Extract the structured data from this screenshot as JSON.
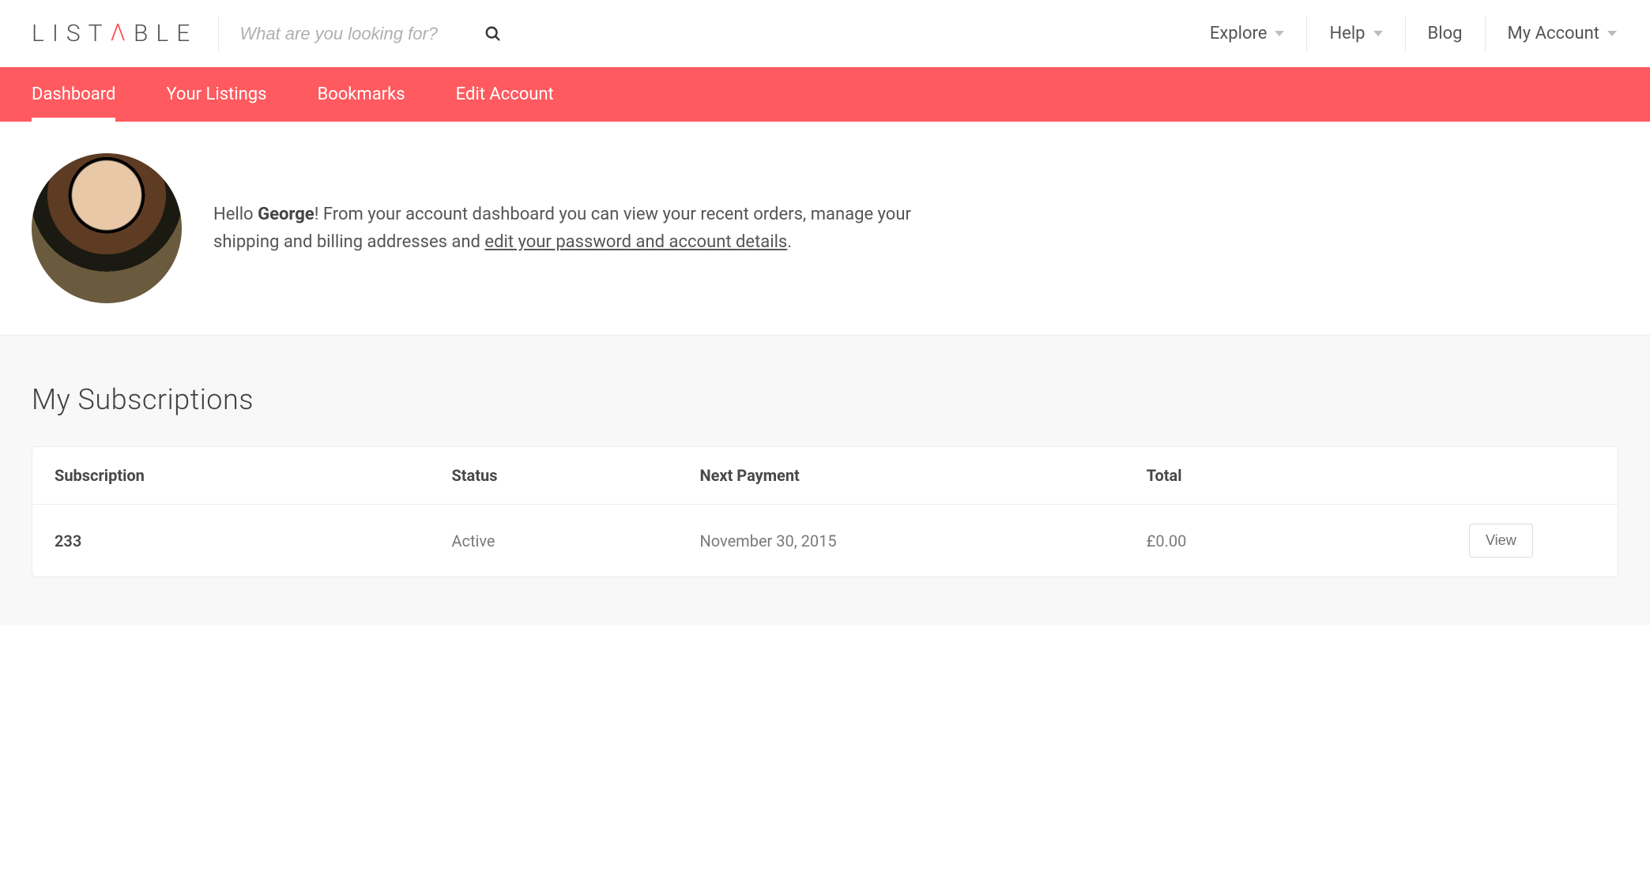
{
  "brand": {
    "name_html_pieces": [
      "L",
      "I",
      "S",
      "T",
      "A",
      "B",
      "L",
      "E"
    ],
    "accent_index": 4
  },
  "search": {
    "placeholder": "What are you looking for?"
  },
  "topnav": {
    "explore": "Explore",
    "help": "Help",
    "blog": "Blog",
    "my_account": "My Account"
  },
  "tabs": {
    "dashboard": "Dashboard",
    "your_listings": "Your Listings",
    "bookmarks": "Bookmarks",
    "edit_account": "Edit Account"
  },
  "welcome": {
    "hello": "Hello ",
    "name": "George",
    "after_name": "! From your account dashboard you can view your recent orders, manage your shipping and billing addresses and ",
    "edit_link": "edit your password and account details",
    "period": "."
  },
  "subscriptions": {
    "title": "My Subscriptions",
    "columns": {
      "subscription": "Subscription",
      "status": "Status",
      "next_payment": "Next Payment",
      "total": "Total"
    },
    "rows": [
      {
        "id": "233",
        "status": "Active",
        "next_payment": "November 30, 2015",
        "total": "£0.00",
        "action": "View"
      }
    ]
  }
}
